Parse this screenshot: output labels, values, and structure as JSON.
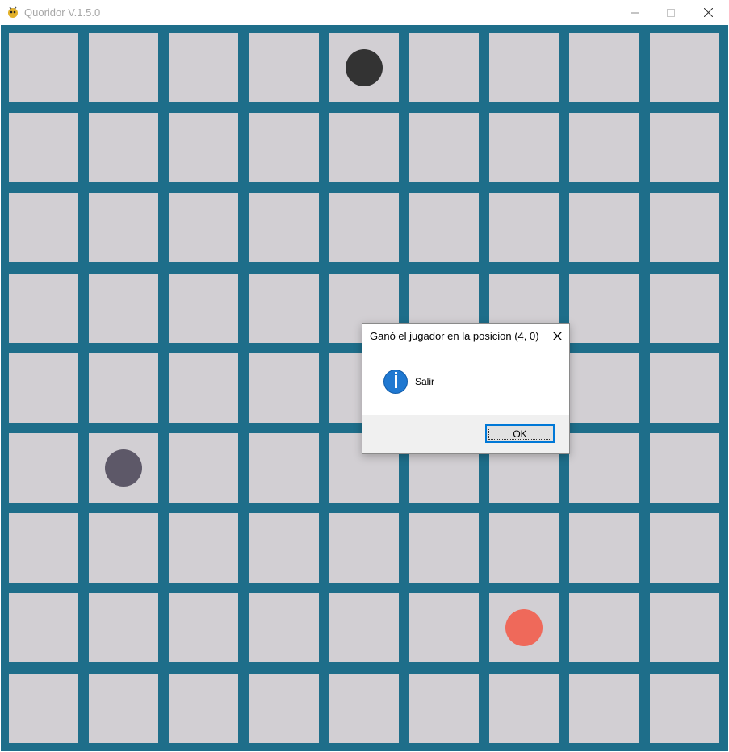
{
  "window": {
    "title": "Quoridor V.1.5.0"
  },
  "board": {
    "rows": 9,
    "cols": 9,
    "colors": {
      "border": "#1e6e8a",
      "cell": "#d2cfd3"
    },
    "pawns": [
      {
        "name": "pawn-black",
        "row": 0,
        "col": 4,
        "color": "#333333"
      },
      {
        "name": "pawn-gray",
        "row": 5,
        "col": 1,
        "color": "#5d5868"
      },
      {
        "name": "pawn-red",
        "row": 7,
        "col": 6,
        "color": "#ef695a"
      }
    ]
  },
  "dialog": {
    "title": "Ganó el jugador en la posicion (4, 0)",
    "message": "Salir",
    "ok_label": "OK",
    "icon": "info-icon"
  }
}
